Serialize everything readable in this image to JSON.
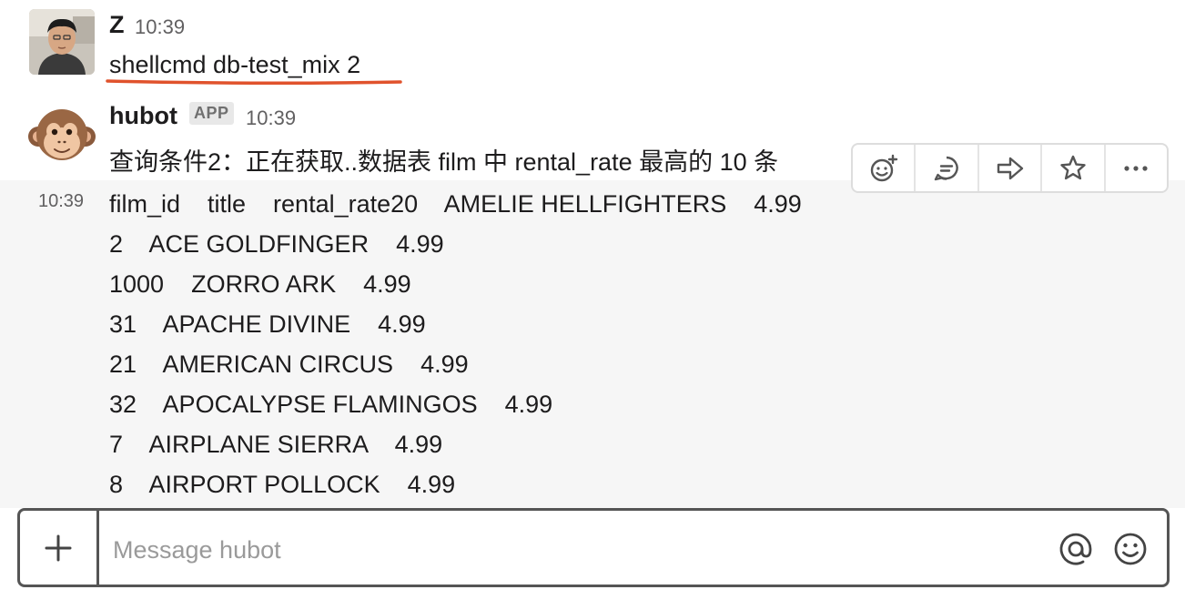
{
  "messages": [
    {
      "author": "Z",
      "time": "10:39",
      "text": "shellcmd db-test_mix 2"
    },
    {
      "author": "hubot",
      "badge": "APP",
      "time": "10:39",
      "text": "查询条件2：正在获取..数据表 film 中 rental_rate 最高的 10 条"
    }
  ],
  "continuation": {
    "time": "10:39",
    "lines": [
      "film_id    title    rental_rate20    AMELIE HELLFIGHTERS    4.99",
      "2    ACE GOLDFINGER    4.99",
      "1000    ZORRO ARK    4.99",
      "31    APACHE DIVINE    4.99",
      "21    AMERICAN CIRCUS    4.99",
      "32    APOCALYPSE FLAMINGOS    4.99",
      "7    AIRPLANE SIERRA    4.99",
      "8    AIRPORT POLLOCK    4.99"
    ]
  },
  "toolbar": {
    "icons": [
      "add-reaction-icon",
      "reply-in-thread-icon",
      "share-message-icon",
      "save-star-icon",
      "more-actions-icon"
    ]
  },
  "composer": {
    "placeholder": "Message hubot",
    "value": ""
  },
  "colors": {
    "annotation_underline": "#e0522c",
    "hover_background": "#f6f6f6"
  }
}
